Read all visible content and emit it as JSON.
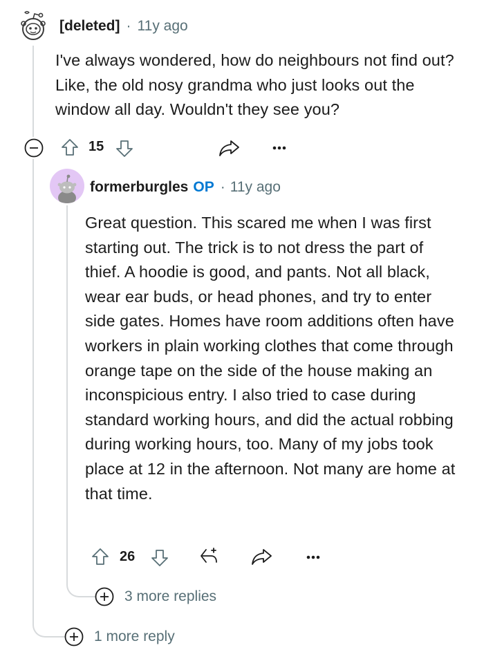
{
  "comment": {
    "author": "[deleted]",
    "separator": "·",
    "time": "11y ago",
    "body": "I've always wondered, how do neighbours not find out? Like, the old nosy grandma who just looks out the window all day. Wouldn't they see you?",
    "votes": "15",
    "icons": [
      "collapse-icon",
      "upvote-icon",
      "downvote-icon",
      "share-icon",
      "more-options-icon"
    ]
  },
  "reply": {
    "author": "formerburgles",
    "op_badge": "OP",
    "separator": "·",
    "time": "11y ago",
    "body": "Great question. This scared me when I was first starting out. The trick is to not dress the part of thief. A hoodie is good, and pants. Not all black, wear ear buds, or head phones, and try to enter side gates. Homes have room additions often have workers in plain working clothes that come through orange tape on the side of the house making an inconspicious entry. I also tried to case during standard working hours, and did the actual robbing during working hours, too. Many of my jobs took place at 12 in the afternoon. Not many are home at that time.",
    "votes": "26",
    "icons": [
      "upvote-icon",
      "downvote-icon",
      "award-icon",
      "share-icon",
      "more-options-icon"
    ],
    "more_replies": "3 more replies"
  },
  "thread": {
    "more_replies": "1 more reply"
  },
  "colors": {
    "text": "#1c1c1c",
    "meta": "#576f76",
    "op": "#0079d3",
    "thread_line": "#d7dadc",
    "avatar_bg": "#e3c7f5"
  }
}
